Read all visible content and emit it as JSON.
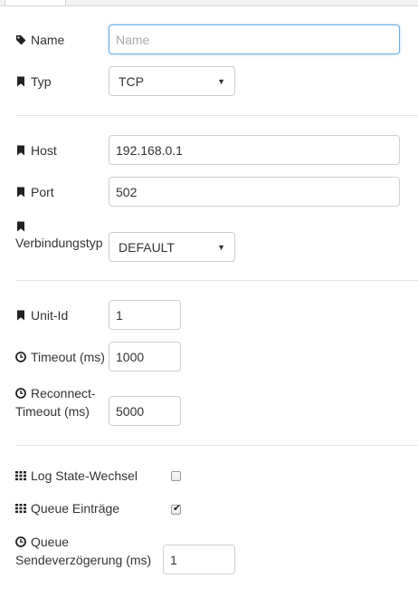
{
  "form": {
    "name": {
      "label": "Name",
      "value": "",
      "placeholder": "Name"
    },
    "typ": {
      "label": "Typ",
      "selected": "TCP"
    },
    "host": {
      "label": "Host",
      "value": "192.168.0.1"
    },
    "port": {
      "label": "Port",
      "value": "502"
    },
    "verbindungstyp": {
      "label": "Verbindungstyp",
      "selected": "DEFAULT"
    },
    "unit_id": {
      "label": "Unit-Id",
      "value": "1"
    },
    "timeout": {
      "label": "Timeout (ms)",
      "value": "1000"
    },
    "reconnect_timeout": {
      "label_line1": "Reconnect-",
      "label_line2": "Timeout (ms)",
      "value": "5000"
    },
    "log_state": {
      "label": "Log State-Wechsel",
      "checked": false
    },
    "queue_entries": {
      "label": "Queue Einträge",
      "checked": true
    },
    "queue_delay": {
      "label_line1": "Queue",
      "label_line2": "Sendeverzögerung (ms)",
      "value": "1"
    }
  },
  "icons": {
    "name": "tag-icon",
    "typ": "bookmark-icon",
    "host": "bookmark-icon",
    "port": "bookmark-icon",
    "verbindungstyp": "bookmark-icon",
    "unit_id": "bookmark-icon",
    "timeout": "clock-icon",
    "reconnect_timeout": "clock-icon",
    "log_state": "grid-icon",
    "queue_entries": "grid-icon",
    "queue_delay": "clock-icon"
  },
  "colors": {
    "focus_border": "#66afe9",
    "divider": "#e3e3e3"
  }
}
